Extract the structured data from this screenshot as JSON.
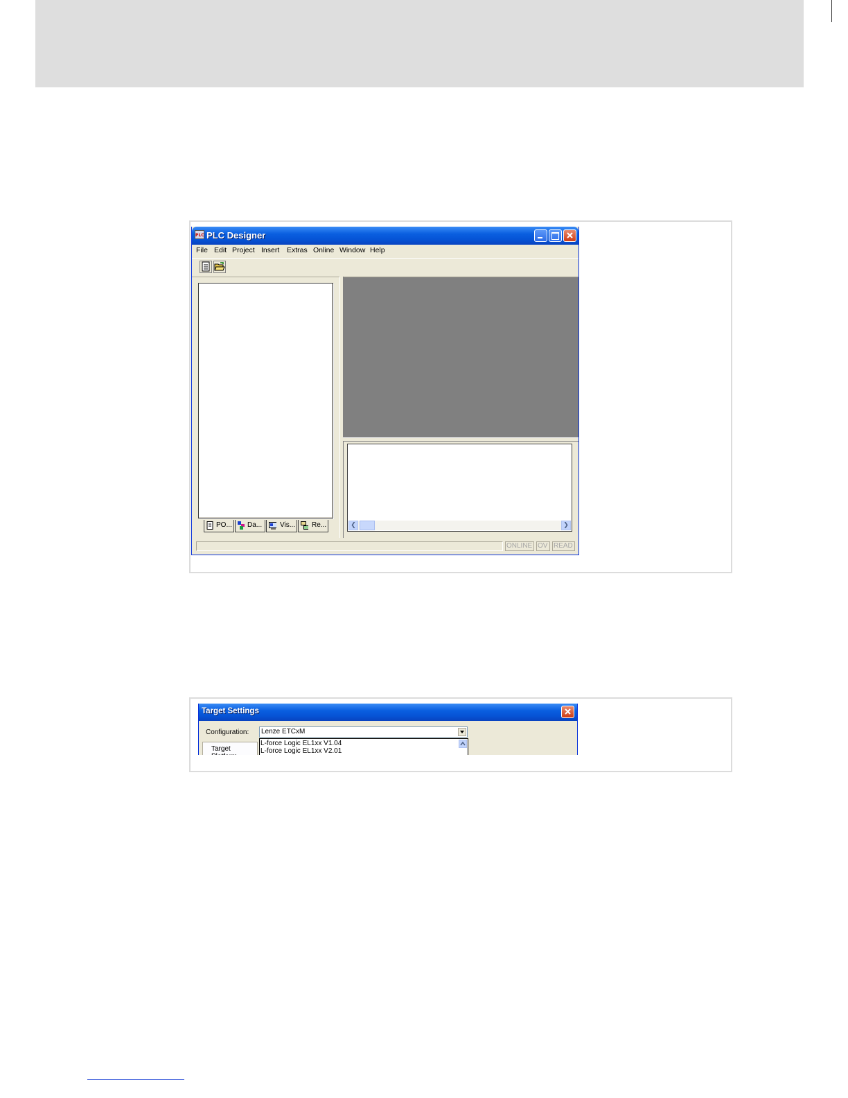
{
  "plc_designer": {
    "title": "PLC Designer",
    "app_icon_text": "PLC",
    "menu": [
      "File",
      "Edit",
      "Project",
      "Insert",
      "Extras",
      "Online",
      "Window",
      "Help"
    ],
    "toolbar": [
      "new-document-icon",
      "open-folder-icon"
    ],
    "tabs": [
      "PO...",
      "Da...",
      "Vis...",
      "Re..."
    ],
    "status": [
      "ONLINE",
      "OV",
      "READ"
    ]
  },
  "target_settings": {
    "title": "Target Settings",
    "configuration_label": "Configuration:",
    "configuration_value": "Lenze ETCxM",
    "options": [
      "L-force Logic EL1xx V1.04",
      "L-force Logic EL1xx V2.01"
    ],
    "tab_label": "Target Platform"
  },
  "colors": {
    "header_band": "#dedede",
    "titlebar": "#0a5fe0",
    "window_face": "#ece9d8",
    "mdi_background": "#808080"
  }
}
